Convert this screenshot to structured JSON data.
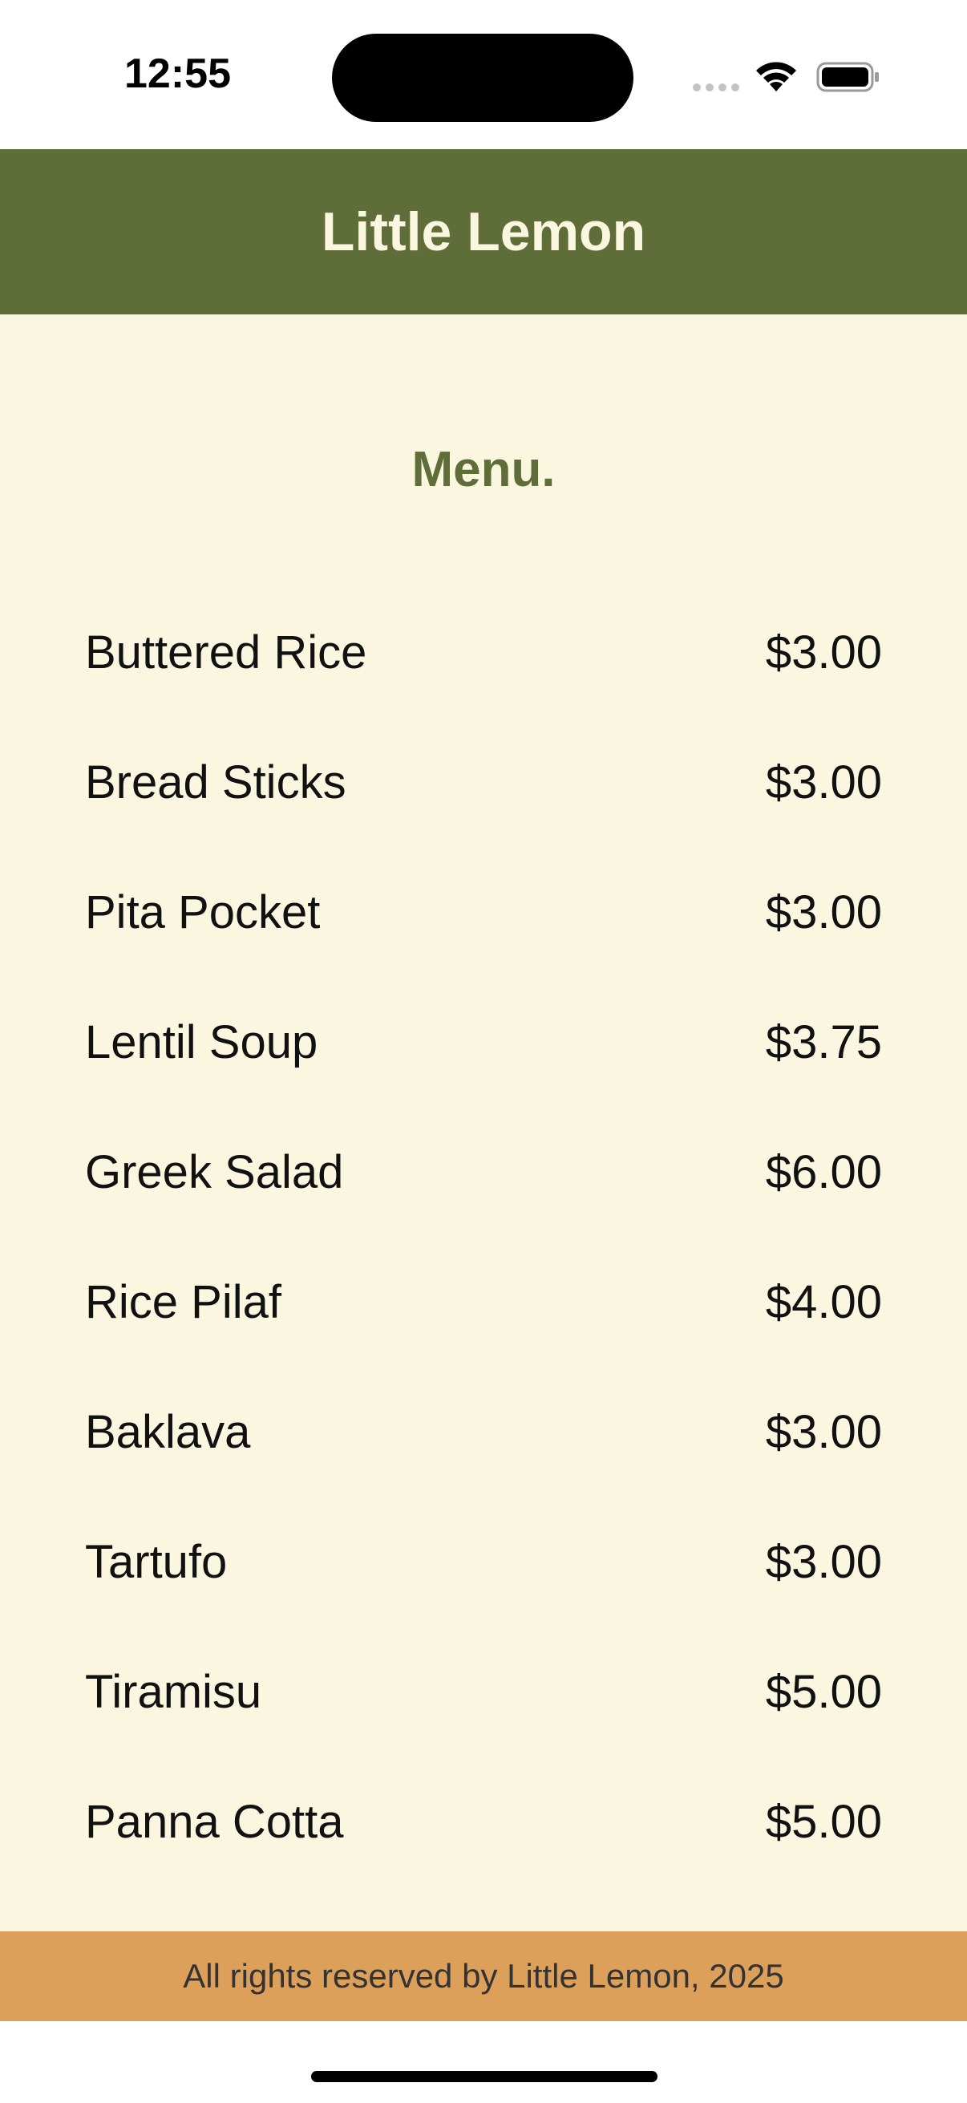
{
  "status_bar": {
    "time": "12:55",
    "icons": [
      "signal-dots-icon",
      "wifi-icon",
      "battery-icon"
    ]
  },
  "header": {
    "title": "Little Lemon"
  },
  "menu": {
    "heading": "Menu.",
    "items": [
      {
        "name": "Buttered Rice",
        "price": "$3.00"
      },
      {
        "name": "Bread Sticks",
        "price": "$3.00"
      },
      {
        "name": "Pita Pocket",
        "price": "$3.00"
      },
      {
        "name": "Lentil Soup",
        "price": "$3.75"
      },
      {
        "name": "Greek Salad",
        "price": "$6.00"
      },
      {
        "name": "Rice Pilaf",
        "price": "$4.00"
      },
      {
        "name": "Baklava",
        "price": "$3.00"
      },
      {
        "name": "Tartufo",
        "price": "$3.00"
      },
      {
        "name": "Tiramisu",
        "price": "$5.00"
      },
      {
        "name": "Panna Cotta",
        "price": "$5.00"
      }
    ]
  },
  "footer": {
    "text": "All rights reserved by Little Lemon, 2025"
  },
  "colors": {
    "header_bg": "#5f6e39",
    "content_bg": "#fbf6e0",
    "footer_bg": "#dca05b",
    "accent_text": "#5f6e39"
  }
}
